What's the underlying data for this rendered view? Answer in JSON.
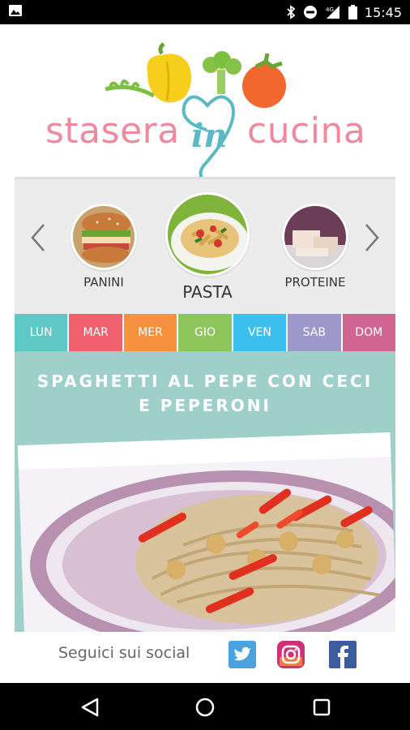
{
  "status_bar": {
    "time": "15:45",
    "icons": [
      "image-icon",
      "bluetooth-icon",
      "do-not-disturb-icon",
      "signal-icon",
      "battery-icon"
    ]
  },
  "logo": {
    "word1": "stasera",
    "word2": "in",
    "word3": "cucina"
  },
  "categories": [
    {
      "label": "PANINI"
    },
    {
      "label": "PASTA"
    },
    {
      "label": "PROTEINE"
    }
  ],
  "days": [
    {
      "label": "LUN",
      "color": "#5ec8c5"
    },
    {
      "label": "MAR",
      "color": "#f0606d"
    },
    {
      "label": "MER",
      "color": "#f6913f"
    },
    {
      "label": "GIO",
      "color": "#8dc45c"
    },
    {
      "label": "VEN",
      "color": "#3cc0ef"
    },
    {
      "label": "SAB",
      "color": "#9c98c9"
    },
    {
      "label": "DOM",
      "color": "#d06592"
    }
  ],
  "recipe": {
    "title": "SPAGHETTI AL PEPE CON CECI E PEPERONI"
  },
  "social": {
    "label": "Seguici sui social",
    "icons": [
      "twitter-icon",
      "instagram-icon",
      "facebook-icon"
    ]
  },
  "nav": {
    "icons": [
      "back-icon",
      "home-icon",
      "recent-apps-icon"
    ]
  }
}
